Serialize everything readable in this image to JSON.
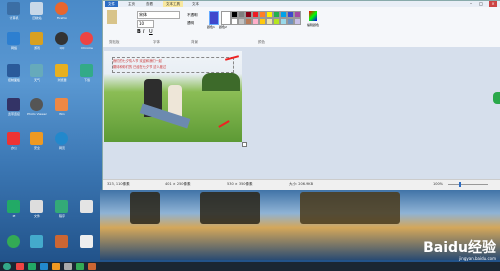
{
  "window": {
    "tabs": [
      "文件",
      "主页",
      "查看",
      "文本工具",
      "文本"
    ],
    "active_tab": "文本工具",
    "ribbon_groups": [
      "剪贴板",
      "字体",
      "背景",
      "颜色"
    ],
    "font_name": "宋体",
    "font_size": "10",
    "bg_options": [
      "不透明",
      "透明"
    ],
    "color_labels": [
      "颜色1",
      "颜色2",
      "编辑颜色"
    ],
    "palette": [
      "#000000",
      "#7f7f7f",
      "#880015",
      "#ed1c24",
      "#ff7f27",
      "#fff200",
      "#22b14c",
      "#00a2e8",
      "#3f48cc",
      "#a349a4",
      "#ffffff",
      "#c3c3c3",
      "#b97a57",
      "#ffaec9",
      "#ffc90e",
      "#efe4b0",
      "#b5e61d",
      "#99d9ea",
      "#7092be",
      "#c8bfe7"
    ],
    "photo_text_line1": "我们的七夕情人节 欢迎和我们一起",
    "photo_text_line2": "期待和你们的 已经在七夕节 这么度过",
    "status": {
      "coord": "323, 110像素",
      "selection": "401 × 250像素",
      "canvas": "530 × 350像素",
      "size": "大小: 206.9KB",
      "zoom": "100%"
    }
  },
  "desktop_icons": [
    {
      "label": "计算机"
    },
    {
      "label": "回收站"
    },
    {
      "label": "Firefox"
    },
    {
      "label": "网络"
    },
    {
      "label": "游戏"
    },
    {
      "label": "QQ"
    },
    {
      "label": "Chrome"
    },
    {
      "label": "控制面板"
    },
    {
      "label": "天气"
    },
    {
      "label": "浏览器"
    },
    {
      "label": "下载"
    },
    {
      "label": "宽带连接"
    },
    {
      "label": "Photo Viewer"
    },
    {
      "label": "Win"
    },
    {
      "label": "办公"
    },
    {
      "label": "安全"
    },
    {
      "label": "网页"
    },
    {
      "label": "IE"
    },
    {
      "label": "文件"
    },
    {
      "label": "程序"
    }
  ],
  "watermark": {
    "brand": "Baidu经验",
    "url": "jingyan.baidu.com"
  }
}
